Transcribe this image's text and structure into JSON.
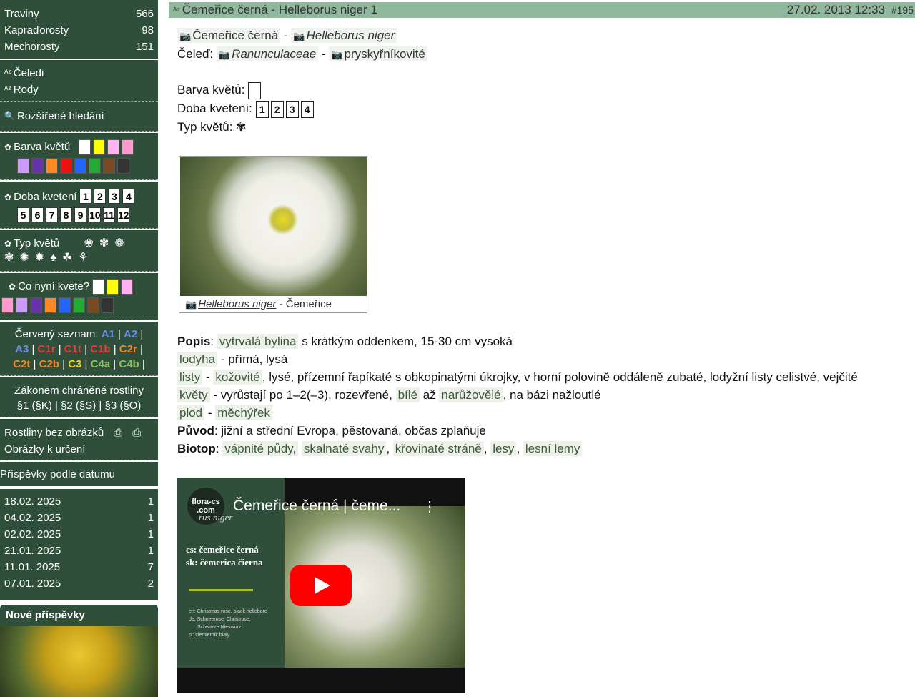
{
  "sidebar": {
    "counts": [
      {
        "label": "Traviny",
        "count": "566"
      },
      {
        "label": "Kapraďorosty",
        "count": "98"
      },
      {
        "label": "Mechorosty",
        "count": "151"
      }
    ],
    "links": [
      "Čeledi",
      "Rody"
    ],
    "advanced": "Rozšířené hledání",
    "color_title": "Barva květů",
    "colors_row1": [
      "#ffffff",
      "#ffff00",
      "#ffb3f0",
      "#ff9ad0"
    ],
    "colors_row2": [
      "#cc99ff",
      "#6633aa",
      "#ff8822",
      "#ee1111",
      "#2266ff",
      "#22aa33",
      "#7a4a22",
      "#333333"
    ],
    "bloom_title": "Doba kvetení",
    "months_row1": [
      "1",
      "2",
      "3",
      "4"
    ],
    "months_row2": [
      "5",
      "6",
      "7",
      "8",
      "9",
      "10",
      "11",
      "12"
    ],
    "type_title": "Typ květů",
    "now_title": "Co nyní kvete?",
    "now_row1": [
      "#ffffff",
      "#ffff00",
      "#ffb3f0"
    ],
    "now_row2": [
      "#ff99cc",
      "#cc99ff",
      "#6633aa",
      "#ff8822",
      "#2266ff",
      "#22aa33",
      "#7a4a22",
      "#333333"
    ],
    "redlist_label": "Červený seznam:",
    "redlist": [
      "A1",
      "A2",
      "A3",
      "C1r",
      "C1t",
      "C1b",
      "C2r",
      "C2t",
      "C2b",
      "C3",
      "C4a",
      "C4b"
    ],
    "protected_title": "Zákonem chráněné rostliny",
    "protected_items": "§1 (§K) | §2 (§S) | §3 (§O)",
    "no_images": "Rostliny bez obrázků",
    "id_images": "Obrázky k určení",
    "by_date_title": "Příspěvky podle datumu",
    "dates": [
      {
        "date": "18.02. 2025",
        "count": "1"
      },
      {
        "date": "04.02. 2025",
        "count": "1"
      },
      {
        "date": "02.02. 2025",
        "count": "1"
      },
      {
        "date": "21.01. 2025",
        "count": "1"
      },
      {
        "date": "11.01. 2025",
        "count": "7"
      },
      {
        "date": "07.01. 2025",
        "count": "2"
      }
    ],
    "new_posts": "Nové příspěvky"
  },
  "header": {
    "title": "Čemeřice černá - Helleborus niger 1",
    "date": "27.02. 2013 12:33",
    "post_no": "#195"
  },
  "names": {
    "czech": "Čemeřice černá",
    "latin": "Helleborus niger",
    "family_label": "Čeleď:",
    "family_latin": "Ranunculaceae",
    "family_czech": "pryskyřníkovité"
  },
  "attrs": {
    "color_label": "Barva květů:",
    "bloom_label": "Doba kvetení:",
    "bloom": [
      "1",
      "2",
      "3",
      "4"
    ],
    "type_label": "Typ květů:"
  },
  "photo": {
    "caption_latin": "Helleborus niger",
    "caption_czech": "- Čemeřice"
  },
  "desc": {
    "popis_label": "Popis",
    "popis_a": "vytrvalá bylina",
    "popis_b": "s krátkým oddenkem, 15-30 cm vysoká",
    "lodyha": "lodyha",
    "lodyha_t": "- přímá, lysá",
    "listy": "listy",
    "listy_a": "kožovité",
    "listy_t": ", lysé, přízemní řapíkaté s obkopinatými úkrojky, v horní polovině oddáleně zubaté, lodyžní listy celistvé, vejčité",
    "kvety": "květy",
    "kvety_t": "- vyrůstají po 1–2(–3), rozevřené,",
    "kvety_a": "bílé",
    "kvety_m": "až",
    "kvety_b": "narůžovělé",
    "kvety_e": ", na bázi nažloutlé",
    "plod": "plod",
    "plod_a": "měchýřek",
    "puvod_label": "Původ",
    "puvod": ": jižní a střední Evropa, pěstovaná, občas zplaňuje",
    "biotop_label": "Biotop",
    "biotop": [
      "vápnité půdy,",
      "skalnaté svahy",
      "křovinaté stráně",
      "lesy",
      "lesní lemy"
    ]
  },
  "video": {
    "logo_top": "flora-cs",
    "logo_bottom": ".com",
    "title": "Čemeřice černá | čeme...",
    "latin": "rus niger",
    "cs": "cs: čemeřice černá",
    "sk": "sk: čemerica čierna",
    "en": "en: Christmas rose, black hellebore",
    "de": "de: Schneerose, Christrose,",
    "de2": "Schwarze Nieswurz",
    "pl": "pl: ciemiernik biały"
  }
}
